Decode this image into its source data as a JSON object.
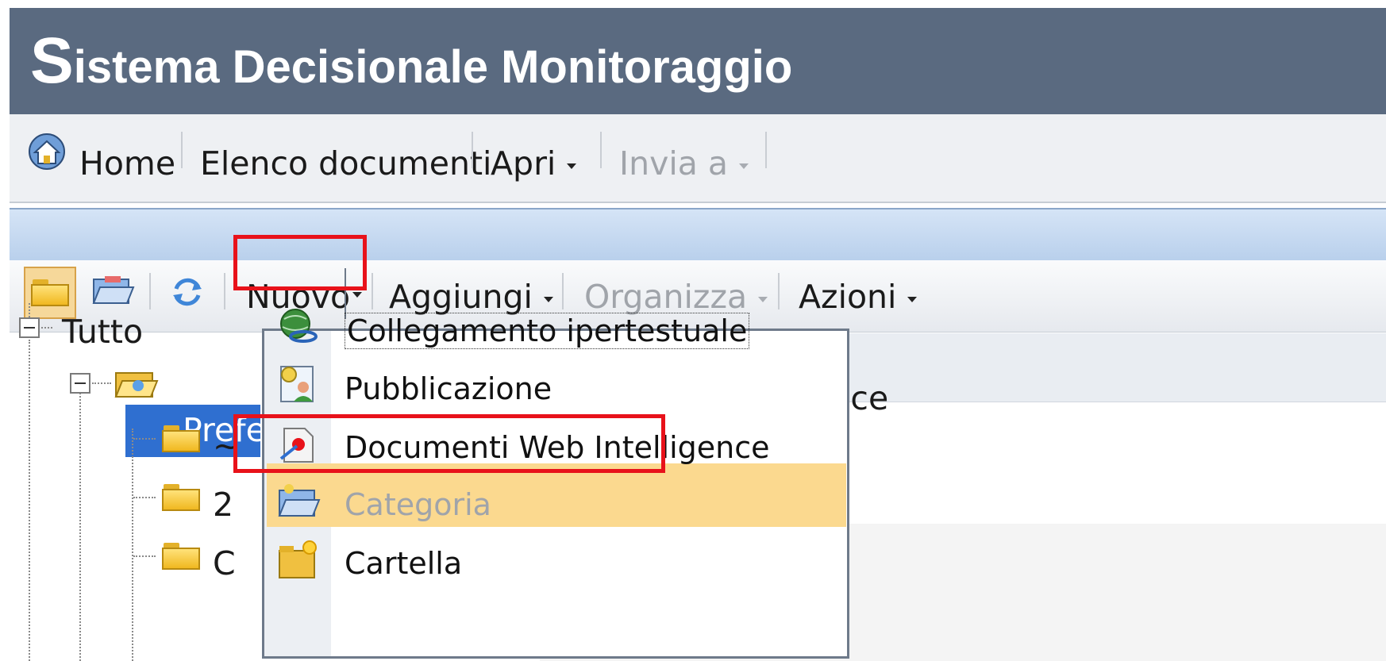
{
  "header": {
    "title_first_letter": "S",
    "title_rest": "istema Decisionale Monitoraggio"
  },
  "top_menu": {
    "items": [
      {
        "label": "Home",
        "enabled": true
      },
      {
        "label": "Elenco documenti",
        "enabled": true
      },
      {
        "label": "Apri",
        "enabled": true,
        "has_dropdown": true
      },
      {
        "label": "Invia a",
        "enabled": false,
        "has_dropdown": true
      }
    ]
  },
  "toolbar": {
    "icons": [
      "folder-icon",
      "open-folder-icon",
      "refresh-icon"
    ],
    "nuovo_label": "Nuovo",
    "aggiungi_label": "Aggiungi",
    "organizza_label": "Organizza",
    "azioni_label": "Azioni"
  },
  "tree": {
    "root_label": "Tutto",
    "selected_label_visible": "Prefe",
    "children_visible": [
      "~",
      "2",
      "C"
    ]
  },
  "right_panel": {
    "partial_text": "lligence"
  },
  "dropdown": {
    "items": [
      {
        "label": "Collegamento ipertestuale",
        "icon": "globe-link-icon",
        "enabled": true
      },
      {
        "label": "Pubblicazione",
        "icon": "publication-icon",
        "enabled": true
      },
      {
        "label": "Documenti Web Intelligence",
        "icon": "webi-document-icon",
        "enabled": true,
        "highlighted": true
      },
      {
        "label": "Categoria",
        "icon": "category-icon",
        "enabled": false
      },
      {
        "label": "Cartella",
        "icon": "new-folder-icon",
        "enabled": true
      }
    ]
  },
  "colors": {
    "title_bar": "#5a6a80",
    "selection": "#2f6fd0",
    "menu_highlight": "#fbd98f",
    "annotation_red": "#e8121a"
  }
}
